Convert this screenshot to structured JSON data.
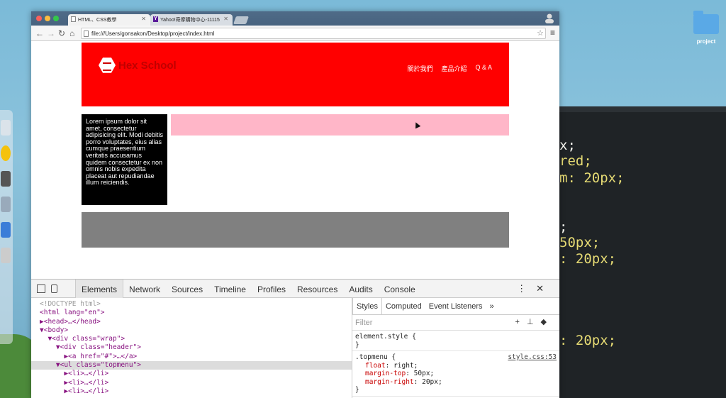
{
  "desktop": {
    "folder_label": "project"
  },
  "editor": {
    "lines": [
      {
        "text": "x;",
        "color": "#f8f8f2"
      },
      {
        "text": "red;",
        "color": "#e6db74"
      },
      {
        "text": "m: 20px;",
        "color": "#e6db74"
      },
      {
        "text": ";",
        "color": "#f8f8f2"
      },
      {
        "text": "50px;",
        "color": "#e6db74"
      },
      {
        "text": ": 20px;",
        "color": "#e6db74"
      },
      {
        "text": ": 20px;",
        "color": "#e6db74"
      }
    ]
  },
  "browser": {
    "tabs": [
      {
        "label": "HTML、CSS教學"
      },
      {
        "label": "Yahoo!奇摩購物中心-11115"
      }
    ],
    "url": "file:///Users/gonsakon/Desktop/project/index.html"
  },
  "site": {
    "logo_text": "Hex School",
    "menu": [
      "關於我們",
      "產品介紹",
      "Q & A"
    ],
    "sidebar_text": "Lorem ipsum dolor sit amet, consectetur adipisicing elit. Modi debitis porro voluptates, eius alias cumque praesentium veritatis accusamus quidem consectetur ex non omnis nobis expedita placeat aut repudiandae illum reiciendis.",
    "colors": {
      "header": "#ff0000",
      "sidebar": "#000000",
      "pink": "#ffb6c8",
      "footer": "#808080"
    }
  },
  "devtools": {
    "tabs": [
      "Elements",
      "Network",
      "Sources",
      "Timeline",
      "Profiles",
      "Resources",
      "Audits",
      "Console"
    ],
    "active_tab": "Elements",
    "dom": [
      "<!DOCTYPE html>",
      "<html lang=\"en\">",
      "▶<head>…</head>",
      "▼<body>",
      "  ▼<div class=\"wrap\">",
      "    ▼<div class=\"header\">",
      "      ▶<a href=\"#\">…</a>",
      "    ▼<ul class=\"topmenu\">",
      "      ▶<li>…</li>",
      "      ▶<li>…</li>",
      "      ▶<li>…</li>"
    ],
    "styles_tabs": [
      "Styles",
      "Computed",
      "Event Listeners",
      "»"
    ],
    "filter_placeholder": "Filter",
    "element_style": "element.style {",
    "element_style_close": "}",
    "rule_selector": ".topmenu {",
    "rule_link": "style.css:53",
    "rule_props": [
      {
        "name": "float",
        "value": "right;"
      },
      {
        "name": "margin-top",
        "value": "50px;"
      },
      {
        "name": "margin-right",
        "value": "20px;"
      }
    ],
    "rule_close": "}"
  }
}
